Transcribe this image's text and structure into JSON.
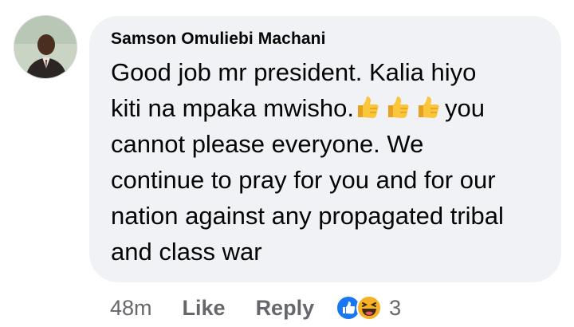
{
  "comment": {
    "author": "Samson Omuliebi Machani",
    "text_line1": "Good job mr president. Kalia hiyo",
    "text_line2_start": "kiti na mpaka mwisho.",
    "text_line2_end": "you",
    "text_rest": "cannot please everyone. We\ncontinue to pray for you and for our\nnation against any propagated tribal\nand class war",
    "inline_emoji": [
      "thumbs-up-icon",
      "thumbs-up-icon",
      "thumbs-up-icon"
    ],
    "timestamp": "48m",
    "like_label": "Like",
    "reply_label": "Reply",
    "reactions": [
      "like-reaction-icon",
      "haha-reaction-icon"
    ],
    "reaction_count": "3"
  },
  "colors": {
    "bubble": "#f0f2f5",
    "text": "#050505",
    "meta": "#65676b",
    "like_blue": "#1877f2",
    "haha_yellow": "#f7b125"
  }
}
